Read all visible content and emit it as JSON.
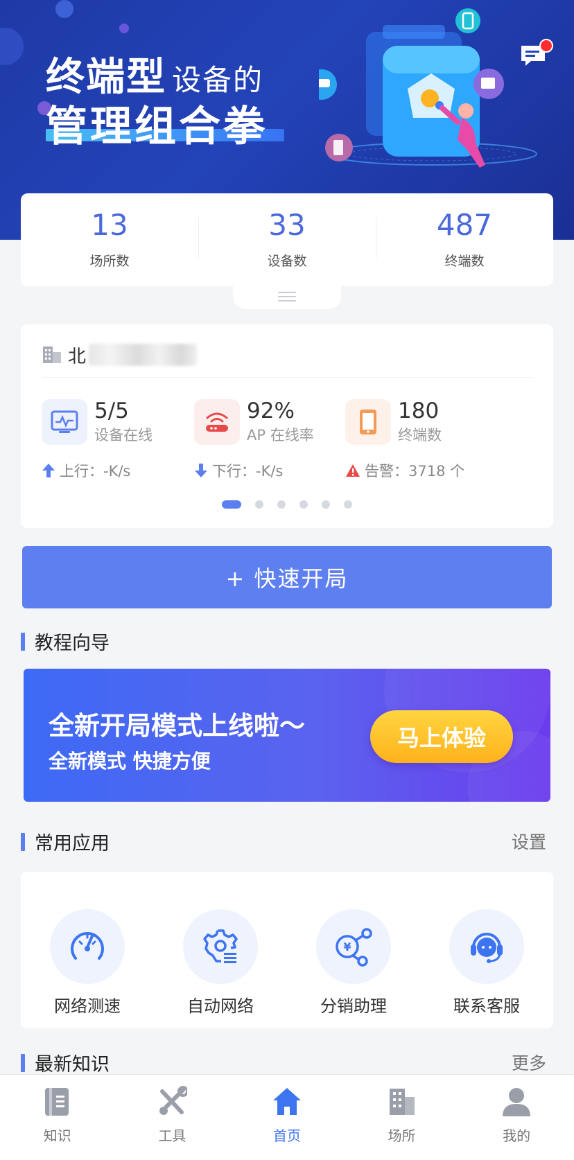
{
  "hero": {
    "title_bold": "终端型",
    "title_rest": "设备的",
    "title_line2": "管理组合拳"
  },
  "stats": [
    {
      "value": "13",
      "label": "场所数"
    },
    {
      "value": "33",
      "label": "设备数"
    },
    {
      "value": "487",
      "label": "终端数"
    }
  ],
  "site": {
    "name": "北"
  },
  "metrics": [
    {
      "value": "5/5",
      "label": "设备在线",
      "icon": "device-monitor-icon"
    },
    {
      "value": "92%",
      "label": "AP 在线率",
      "icon": "wifi-router-icon"
    },
    {
      "value": "180",
      "label": "终端数",
      "icon": "phone-icon"
    }
  ],
  "rates": {
    "up": "上行：-K/s",
    "down": "下行：-K/s",
    "alert": "告警：3718 个"
  },
  "carousel": {
    "count": 6,
    "active": 0
  },
  "quick_start": "+ 快速开局",
  "tutorial": {
    "title": "教程向导",
    "promo_title": "全新开局模式上线啦～",
    "promo_sub": "全新模式 快捷方便",
    "promo_button": "马上体验"
  },
  "apps": {
    "title": "常用应用",
    "settings": "设置",
    "items": [
      {
        "label": "网络测速",
        "icon": "speedometer-icon"
      },
      {
        "label": "自动网络",
        "icon": "gear-auto-icon"
      },
      {
        "label": "分销助理",
        "icon": "yuan-share-icon"
      },
      {
        "label": "联系客服",
        "icon": "headset-icon"
      }
    ]
  },
  "knowledge": {
    "title": "最新知识",
    "more": "更多"
  },
  "nav": [
    {
      "label": "知识",
      "icon": "book-icon"
    },
    {
      "label": "工具",
      "icon": "tools-icon"
    },
    {
      "label": "首页",
      "icon": "home-icon",
      "active": true
    },
    {
      "label": "场所",
      "icon": "building-icon"
    },
    {
      "label": "我的",
      "icon": "user-icon"
    }
  ],
  "colors": {
    "accent": "#5b7ef0",
    "stat_value": "#4a68d9",
    "nav_active": "#3d74f0",
    "alert": "#e84a4a",
    "promo_button": "#ffc12e"
  }
}
